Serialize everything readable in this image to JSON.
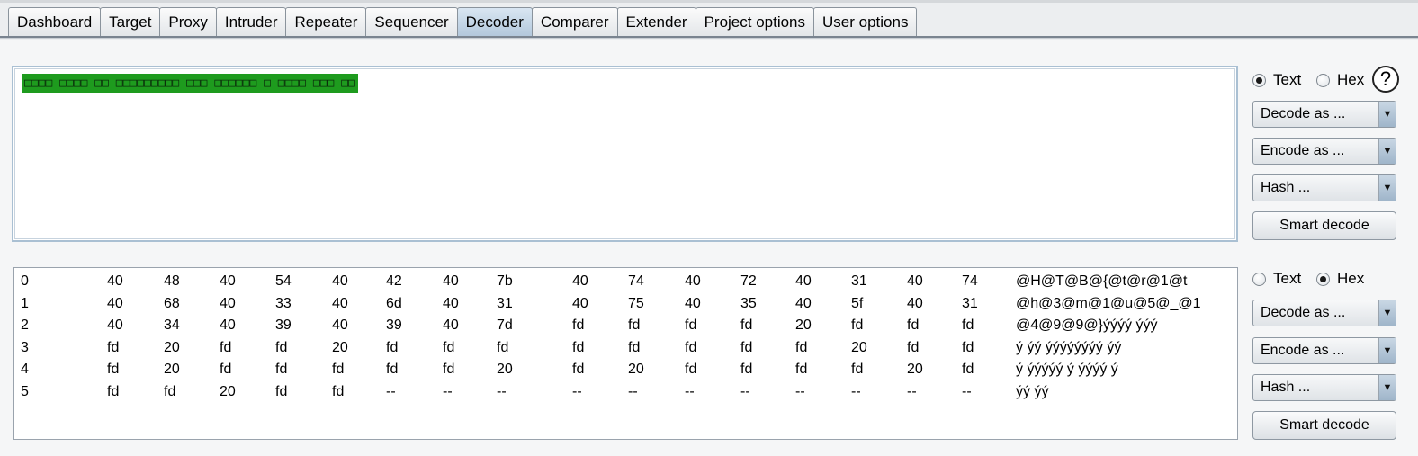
{
  "tabs": [
    "Dashboard",
    "Target",
    "Proxy",
    "Intruder",
    "Repeater",
    "Sequencer",
    "Decoder",
    "Comparer",
    "Extender",
    "Project options",
    "User options"
  ],
  "active_tab": "Decoder",
  "input_panel": {
    "selected_text": "□□□□ □□□□ □□ □□□□□□□□□ □□□ □□□□□□ □ □□□□ □□□ □□",
    "selection_color": "#1e9b1e",
    "mode": {
      "text": "Text",
      "hex": "Hex",
      "selected": "Text"
    },
    "help": "?",
    "decode": "Decode as ...",
    "encode": "Encode as ...",
    "hash": "Hash ...",
    "smart": "Smart decode"
  },
  "output_panel": {
    "mode": {
      "text": "Text",
      "hex": "Hex",
      "selected": "Hex"
    },
    "decode": "Decode as ...",
    "encode": "Encode as ...",
    "hash": "Hash ...",
    "smart": "Smart decode",
    "hex_rows": [
      {
        "index": "0",
        "bytes": [
          "40",
          "48",
          "40",
          "54",
          "40",
          "42",
          "40",
          "7b",
          "40",
          "74",
          "40",
          "72",
          "40",
          "31",
          "40",
          "74"
        ],
        "ascii": "@H@T@B@{@t@r@1@t"
      },
      {
        "index": "1",
        "bytes": [
          "40",
          "68",
          "40",
          "33",
          "40",
          "6d",
          "40",
          "31",
          "40",
          "75",
          "40",
          "35",
          "40",
          "5f",
          "40",
          "31"
        ],
        "ascii": "@h@3@m@1@u@5@_@1"
      },
      {
        "index": "2",
        "bytes": [
          "40",
          "34",
          "40",
          "39",
          "40",
          "39",
          "40",
          "7d",
          "fd",
          "fd",
          "fd",
          "fd",
          "20",
          "fd",
          "fd",
          "fd"
        ],
        "ascii": "@4@9@9@}ýýýý ýýý"
      },
      {
        "index": "3",
        "bytes": [
          "fd",
          "20",
          "fd",
          "fd",
          "20",
          "fd",
          "fd",
          "fd",
          "fd",
          "fd",
          "fd",
          "fd",
          "fd",
          "20",
          "fd",
          "fd"
        ],
        "ascii": "ý ýý ýýýýýýýý ýý"
      },
      {
        "index": "4",
        "bytes": [
          "fd",
          "20",
          "fd",
          "fd",
          "fd",
          "fd",
          "fd",
          "20",
          "fd",
          "20",
          "fd",
          "fd",
          "fd",
          "fd",
          "20",
          "fd"
        ],
        "ascii": "ý ýýýýý ý ýýýý ý"
      },
      {
        "index": "5",
        "bytes": [
          "fd",
          "fd",
          "20",
          "fd",
          "fd",
          "--",
          "--",
          "--",
          "--",
          "--",
          "--",
          "--",
          "--",
          "--",
          "--",
          "--"
        ],
        "ascii": "ýý ýý"
      }
    ]
  }
}
